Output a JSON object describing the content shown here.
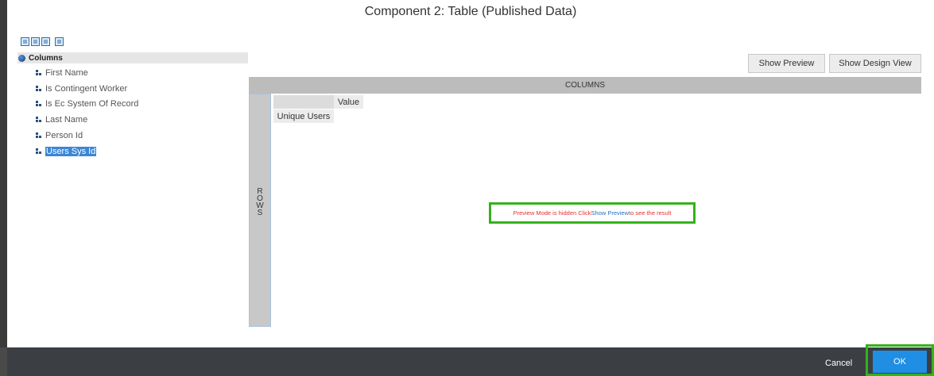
{
  "dialog": {
    "title": "Component 2: Table (Published Data)"
  },
  "toolbar": {
    "icons": [
      "new-icon",
      "database-icon",
      "checkbox-icon",
      "save-icon"
    ]
  },
  "tree": {
    "root_label": "Columns",
    "items": [
      {
        "label": "First Name"
      },
      {
        "label": "Is Contingent Worker"
      },
      {
        "label": "Is Ec System Of Record"
      },
      {
        "label": "Last Name"
      },
      {
        "label": "Person Id"
      },
      {
        "label": "Users Sys Id",
        "selected": true
      }
    ]
  },
  "buttons": {
    "show_preview": "Show Preview",
    "show_design_view": "Show Design View"
  },
  "grid": {
    "columns_label": "COLUMNS",
    "rows_label": "R\nO\nW\nS",
    "value_header": "Value",
    "row_header": "Unique Users"
  },
  "preview_message": {
    "part1": "Preview Mode is hidden  Click ",
    "link": "Show Preview",
    "part2": " to see the result"
  },
  "footer": {
    "cancel_label": "Cancel",
    "ok_label": "OK"
  },
  "colors": {
    "highlight": "#34b21b",
    "primary": "#1f8ee3",
    "footer": "#3b3f44"
  }
}
